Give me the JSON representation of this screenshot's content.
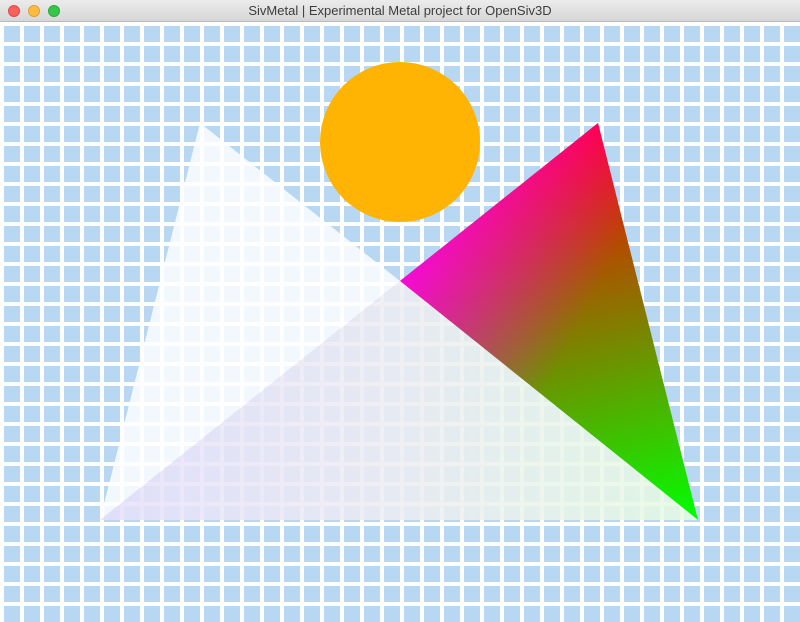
{
  "window": {
    "title": "SivMetal | Experimental Metal project for OpenSiv3D"
  },
  "scene": {
    "background_color": "#ffffff",
    "grid_cell_color": "#b8d7f2",
    "circle_color": "#ffb302",
    "left_triangle_color": "#ffffff",
    "gradient_triangle_colors": [
      "#ff0000",
      "#00ff00",
      "#ff00ff"
    ]
  }
}
